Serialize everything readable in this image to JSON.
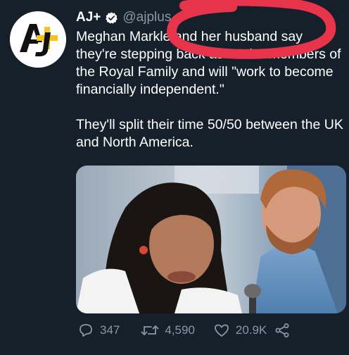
{
  "tweet": {
    "author_name": "AJ+",
    "handle": "@ajplus",
    "lines": [
      "Meghan Markle and her husband say they're stepping back as senior members of the Royal Family and will \"work to become financially independent.\"",
      "They'll split their time 50/50 between the UK and North America."
    ],
    "icons": {
      "avatar": "aj-plus-logo",
      "verified": "verified-badge-icon",
      "reply": "reply-icon",
      "retweet": "retweet-icon",
      "like": "heart-icon",
      "share": "share-icon"
    },
    "stats": {
      "replies": "347",
      "retweets": "4,590",
      "likes": "20.9K"
    }
  },
  "colors": {
    "background": "#15202b",
    "text": "#ffffff",
    "muted": "#8899a6",
    "verified": "#ffffff",
    "logo_yellow": "#f6c21c",
    "annotation_red": "#e8344a"
  }
}
